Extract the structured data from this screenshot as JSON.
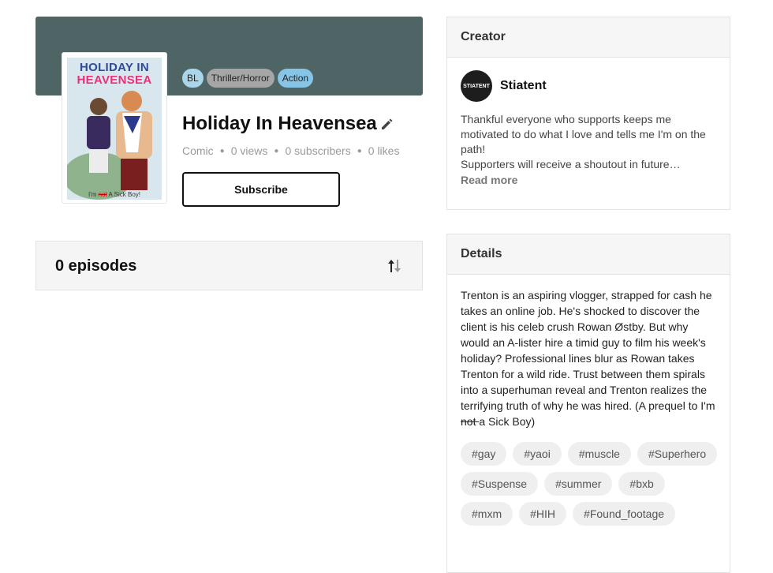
{
  "series": {
    "title": "Holiday In Heavensea",
    "genres": [
      "BL",
      "Thriller/Horror",
      "Action"
    ],
    "type": "Comic",
    "views": "0 views",
    "subscribers": "0 subscribers",
    "likes": "0 likes",
    "subscribe_label": "Subscribe",
    "cover": {
      "title_line1": "HOLIDAY IN",
      "title_line2": "HEAVENSEA",
      "caption_pre": "I'm ",
      "caption_strike": "not",
      "caption_post": " A Sick Boy!"
    }
  },
  "episodes": {
    "count_label": "0 episodes",
    "sort_icon": "sort-arrows-icon"
  },
  "creator": {
    "heading": "Creator",
    "name": "Stiatent",
    "avatar_text": "STIATENT",
    "bio_line1": "Thankful everyone who supports keeps me motivated to do what I love and tells me I'm on the path!",
    "bio_line2": "Supporters will receive a shoutout in future…",
    "read_more": "Read more"
  },
  "details": {
    "heading": "Details",
    "description_main": "Trenton is an aspiring vlogger, strapped for cash he takes an online job. He's shocked to discover the client is his celeb crush Rowan Østby. But why would an A-lister hire a timid guy to film his week's holiday? Professional lines blur as Rowan takes Trenton for a wild ride. Trust between them spirals into a superhuman reveal and Trenton realizes the terrifying truth of why he was hired. (A prequel to I'm",
    "description_strike": " not ",
    "description_end": "a Sick Boy)",
    "tags": [
      "#gay",
      "#yaoi",
      "#muscle",
      "#Superhero",
      "#Suspense",
      "#summer",
      "#bxb",
      "#mxm",
      "#HIH",
      "#Found_footage"
    ]
  },
  "colors": {
    "banner": "#4f6464",
    "pill_bl": "#a9d6e8",
    "pill_thriller": "#a6a6a6",
    "pill_action": "#87c5e6"
  }
}
